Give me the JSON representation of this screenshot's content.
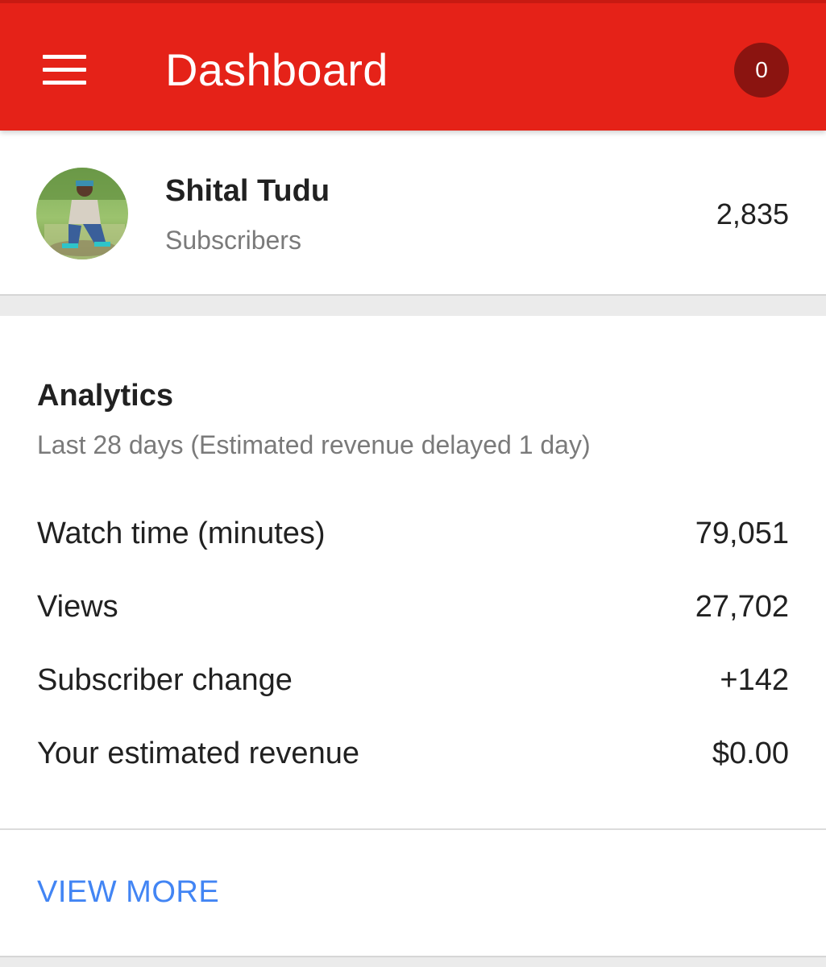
{
  "app_bar": {
    "title": "Dashboard",
    "notification_count": "0",
    "background_color": "#e52218",
    "menu_icon": "hamburger-menu-icon"
  },
  "channel": {
    "name": "Shital Tudu",
    "subscribers_label": "Subscribers",
    "subscriber_count": "2,835"
  },
  "analytics": {
    "title": "Analytics",
    "subtitle": "Last 28 days (Estimated revenue delayed 1 day)",
    "metrics": [
      {
        "label": "Watch time (minutes)",
        "value": "79,051"
      },
      {
        "label": "Views",
        "value": "27,702"
      },
      {
        "label": "Subscriber change",
        "value": "+142"
      },
      {
        "label": "Your estimated revenue",
        "value": "$0.00"
      }
    ],
    "view_more_label": "VIEW MORE",
    "link_color": "#4285f4"
  }
}
